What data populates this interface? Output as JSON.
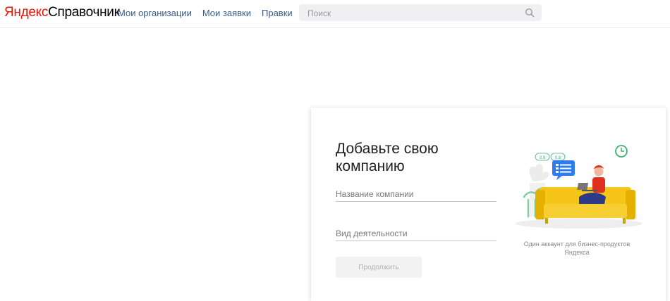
{
  "header": {
    "logo_brand": "Яндекс",
    "logo_product": "Справочник",
    "nav": [
      {
        "label": "Мои организации"
      },
      {
        "label": "Мои заявки"
      },
      {
        "label": "Правки"
      }
    ],
    "search": {
      "placeholder": "Поиск",
      "value": "",
      "icon": "search-icon"
    }
  },
  "form": {
    "title": "Добавьте свою компанию",
    "company_name_placeholder": "Название компании",
    "activity_placeholder": "Вид деятельности",
    "continue_label": "Продолжить",
    "illustration_caption": "Один аккаунт для бизнес-продуктов Яндекса",
    "illustration_labels": {
      "badge_left": "0.9",
      "badge_right": "0.8"
    }
  },
  "colors": {
    "brand_red": "#e61400",
    "nav_link": "#3a5a86",
    "sofa_yellow": "#f5c518",
    "chat_blue": "#2d7cf6",
    "accent_green": "#3bb273"
  }
}
